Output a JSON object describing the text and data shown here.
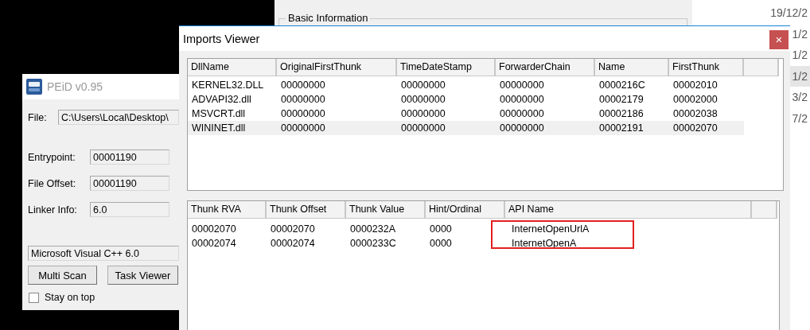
{
  "pe_details_window": {
    "group_label": "Basic Information"
  },
  "file_list": {
    "dates": [
      {
        "text": "19/12/2",
        "selected": false
      },
      {
        "text": "1/2",
        "selected": false
      },
      {
        "text": "1/2",
        "selected": false
      },
      {
        "text": "1/2",
        "selected": true
      },
      {
        "text": "3/2",
        "selected": false
      },
      {
        "text": "7/2",
        "selected": false
      }
    ]
  },
  "peid": {
    "title": "PEiD v0.95",
    "file_label": "File:",
    "file_value": "C:\\Users\\Local\\Desktop\\",
    "fields": [
      {
        "label": "Entrypoint:",
        "value": "00001190"
      },
      {
        "label": "File Offset:",
        "value": "00001190"
      },
      {
        "label": "Linker Info:",
        "value": "6.0"
      }
    ],
    "detected": "Microsoft Visual C++ 6.0",
    "buttons": [
      "Multi Scan",
      "Task Viewer"
    ],
    "stay_on_top": {
      "label": "Stay on top",
      "checked": false
    }
  },
  "imports_viewer": {
    "title": "Imports Viewer",
    "close_glyph": "×",
    "dll_table": {
      "columns": [
        "DllName",
        "OriginalFirstThunk",
        "TimeDateStamp",
        "ForwarderChain",
        "Name",
        "FirstThunk"
      ],
      "rows": [
        {
          "cells": [
            "KERNEL32.DLL",
            "00000000",
            "00000000",
            "00000000",
            "0000216C",
            "00002010"
          ],
          "selected": false
        },
        {
          "cells": [
            "ADVAPI32.dll",
            "00000000",
            "00000000",
            "00000000",
            "00002179",
            "00002000"
          ],
          "selected": false
        },
        {
          "cells": [
            "MSVCRT.dll",
            "00000000",
            "00000000",
            "00000000",
            "00002186",
            "00002038"
          ],
          "selected": false
        },
        {
          "cells": [
            "WININET.dll",
            "00000000",
            "00000000",
            "00000000",
            "00002191",
            "00002070"
          ],
          "selected": true
        }
      ]
    },
    "thunk_table": {
      "columns": [
        "Thunk RVA",
        "Thunk Offset",
        "Thunk Value",
        "Hint/Ordinal",
        "API Name"
      ],
      "rows": [
        {
          "cells": [
            "00002070",
            "00002070",
            "0000232A",
            "0000",
            "InternetOpenUrlA"
          ]
        },
        {
          "cells": [
            "00002074",
            "00002074",
            "0000233C",
            "0000",
            "InternetOpenA"
          ]
        }
      ]
    }
  }
}
